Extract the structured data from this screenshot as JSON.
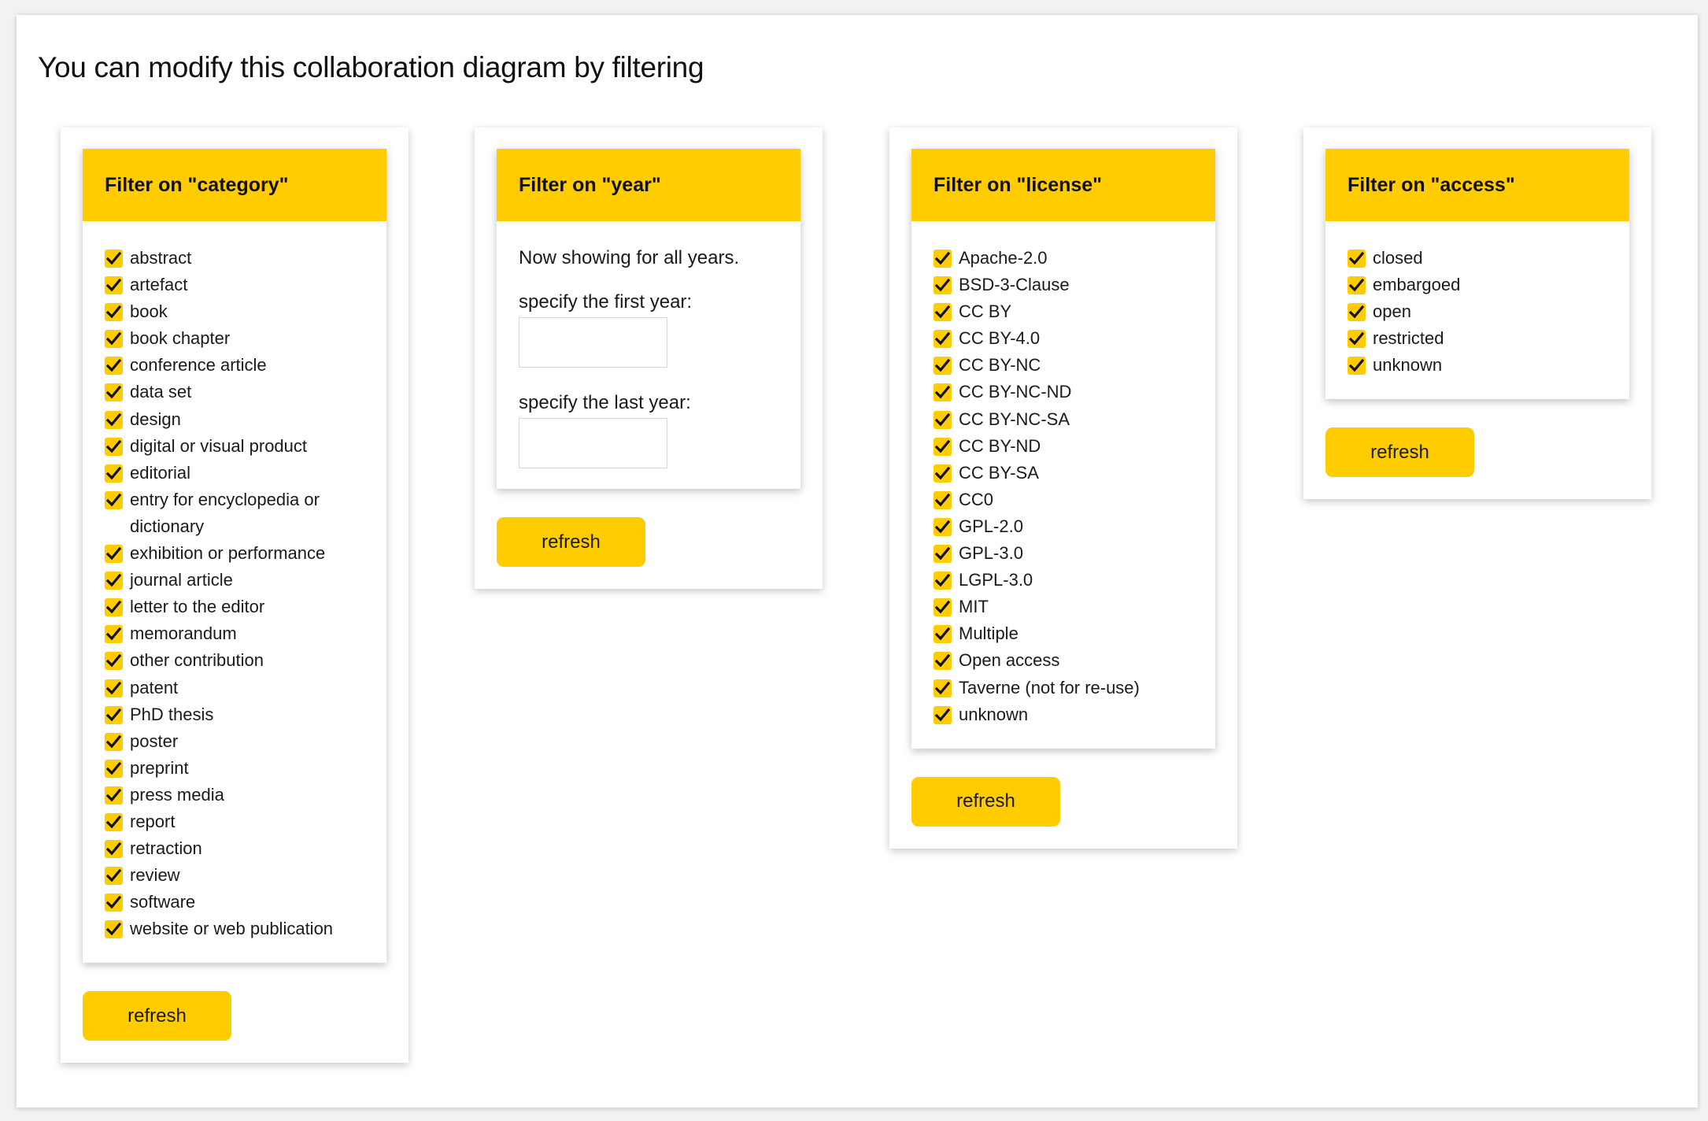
{
  "title": "You can modify this collaboration diagram by filtering",
  "colors": {
    "accent": "#ffcc00",
    "page_background": "#f2f2f2",
    "card_background": "#ffffff",
    "text": "#1a1a1a"
  },
  "icons": {
    "checkbox_checked": "check-icon"
  },
  "filters": {
    "category": {
      "header": "Filter on \"category\"",
      "options": [
        {
          "label": "abstract",
          "checked": true
        },
        {
          "label": "artefact",
          "checked": true
        },
        {
          "label": "book",
          "checked": true
        },
        {
          "label": "book chapter",
          "checked": true
        },
        {
          "label": "conference article",
          "checked": true
        },
        {
          "label": "data set",
          "checked": true
        },
        {
          "label": "design",
          "checked": true
        },
        {
          "label": "digital or visual product",
          "checked": true
        },
        {
          "label": "editorial",
          "checked": true
        },
        {
          "label": "entry for encyclopedia or dictionary",
          "checked": true
        },
        {
          "label": "exhibition or performance",
          "checked": true
        },
        {
          "label": "journal article",
          "checked": true
        },
        {
          "label": "letter to the editor",
          "checked": true
        },
        {
          "label": "memorandum",
          "checked": true
        },
        {
          "label": "other contribution",
          "checked": true
        },
        {
          "label": "patent",
          "checked": true
        },
        {
          "label": "PhD thesis",
          "checked": true
        },
        {
          "label": "poster",
          "checked": true
        },
        {
          "label": "preprint",
          "checked": true
        },
        {
          "label": "press media",
          "checked": true
        },
        {
          "label": "report",
          "checked": true
        },
        {
          "label": "retraction",
          "checked": true
        },
        {
          "label": "review",
          "checked": true
        },
        {
          "label": "software",
          "checked": true
        },
        {
          "label": "website or web publication",
          "checked": true
        }
      ],
      "refresh_label": "refresh"
    },
    "year": {
      "header": "Filter on \"year\"",
      "status": "Now showing for all years.",
      "first_label": "specify the first year:",
      "first_value": "",
      "first_placeholder": "",
      "last_label": "specify the last year:",
      "last_value": "",
      "last_placeholder": "",
      "refresh_label": "refresh"
    },
    "license": {
      "header": "Filter on \"license\"",
      "options": [
        {
          "label": "Apache-2.0",
          "checked": true
        },
        {
          "label": "BSD-3-Clause",
          "checked": true
        },
        {
          "label": "CC BY",
          "checked": true
        },
        {
          "label": "CC BY-4.0",
          "checked": true
        },
        {
          "label": "CC BY-NC",
          "checked": true
        },
        {
          "label": "CC BY-NC-ND",
          "checked": true
        },
        {
          "label": "CC BY-NC-SA",
          "checked": true
        },
        {
          "label": "CC BY-ND",
          "checked": true
        },
        {
          "label": "CC BY-SA",
          "checked": true
        },
        {
          "label": "CC0",
          "checked": true
        },
        {
          "label": "GPL-2.0",
          "checked": true
        },
        {
          "label": "GPL-3.0",
          "checked": true
        },
        {
          "label": "LGPL-3.0",
          "checked": true
        },
        {
          "label": "MIT",
          "checked": true
        },
        {
          "label": "Multiple",
          "checked": true
        },
        {
          "label": "Open access",
          "checked": true
        },
        {
          "label": "Taverne (not for re-use)",
          "checked": true
        },
        {
          "label": "unknown",
          "checked": true
        }
      ],
      "refresh_label": "refresh"
    },
    "access": {
      "header": "Filter on \"access\"",
      "options": [
        {
          "label": "closed",
          "checked": true
        },
        {
          "label": "embargoed",
          "checked": true
        },
        {
          "label": "open",
          "checked": true
        },
        {
          "label": "restricted",
          "checked": true
        },
        {
          "label": "unknown",
          "checked": true
        }
      ],
      "refresh_label": "refresh"
    }
  }
}
